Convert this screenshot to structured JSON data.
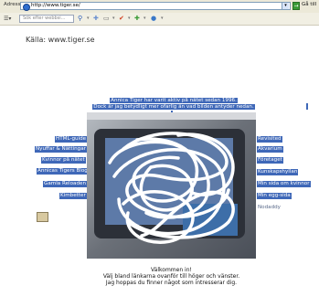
{
  "address_bar": {
    "label": "Adress",
    "url": "http://www.tiger.se/",
    "go_label": "Gå till"
  },
  "toolbar": {
    "search_placeholder": "Sök efter webbsi..."
  },
  "page": {
    "source": "Källa: www.tiger.se",
    "intro_line1": "Annica Tiger har varit aktiv på nätet sedan 1996.",
    "intro_line2": "Dock är jag betydligt mer ofarlig än vad bilden antyder nedan.",
    "left_links": [
      "HTML-guide",
      "Nyuffar & Nättingar",
      "Kvinnor på nätet",
      "Annicas Tigers Blog",
      "Gamla Reloaden",
      "Kimbetter"
    ],
    "right_links": [
      "Revisited",
      "Akvarium",
      "Företaget",
      "Kunskapshyllan",
      "Min sida om kvinnor",
      "Min egg-sida",
      "Nodaddy"
    ],
    "welcome_line1": "Välkommen in!",
    "welcome_line2": "Välj bland länkarna ovanför till höger och vänster.",
    "welcome_line3": "Jag hoppas du finner något som intresserar dig."
  },
  "colors": {
    "link_bg": "#3f68b8",
    "address_bar_bg": "#ece9d8"
  }
}
